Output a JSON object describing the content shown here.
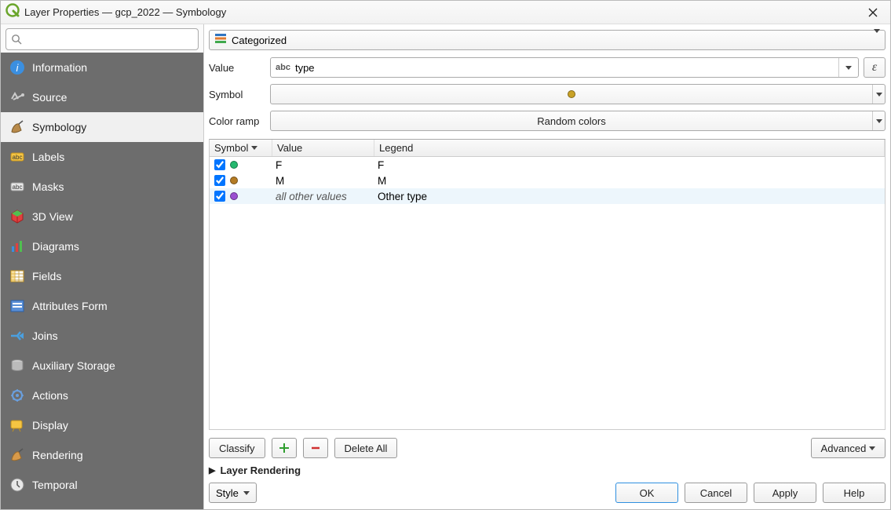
{
  "title": "Layer Properties — gcp_2022 — Symbology",
  "search": {
    "placeholder": ""
  },
  "sidebar": {
    "items": [
      {
        "id": "information",
        "label": "Information"
      },
      {
        "id": "source",
        "label": "Source"
      },
      {
        "id": "symbology",
        "label": "Symbology"
      },
      {
        "id": "labels",
        "label": "Labels"
      },
      {
        "id": "masks",
        "label": "Masks"
      },
      {
        "id": "3dview",
        "label": "3D View"
      },
      {
        "id": "diagrams",
        "label": "Diagrams"
      },
      {
        "id": "fields",
        "label": "Fields"
      },
      {
        "id": "attributes-form",
        "label": "Attributes Form"
      },
      {
        "id": "joins",
        "label": "Joins"
      },
      {
        "id": "auxiliary-storage",
        "label": "Auxiliary Storage"
      },
      {
        "id": "actions",
        "label": "Actions"
      },
      {
        "id": "display",
        "label": "Display"
      },
      {
        "id": "rendering",
        "label": "Rendering"
      },
      {
        "id": "temporal",
        "label": "Temporal"
      }
    ],
    "selected": "symbology"
  },
  "renderer": {
    "type": "Categorized"
  },
  "params": {
    "value_label": "Value",
    "value_prefix": "abc",
    "value_field": "type",
    "symbol_label": "Symbol",
    "symbol_color": "#c9a227",
    "color_ramp_label": "Color ramp",
    "color_ramp_value": "Random colors"
  },
  "class_table": {
    "headers": {
      "symbol": "Symbol",
      "value": "Value",
      "legend": "Legend"
    },
    "rows": [
      {
        "checked": true,
        "color": "#25b86f",
        "value": "F",
        "legend": "F",
        "italic": false,
        "highlight": false
      },
      {
        "checked": true,
        "color": "#b47b24",
        "value": "M",
        "legend": "M",
        "italic": false,
        "highlight": false
      },
      {
        "checked": true,
        "color": "#9b4fd1",
        "value": "all other values",
        "legend": "Other type",
        "italic": true,
        "highlight": true
      }
    ]
  },
  "actions": {
    "classify": "Classify",
    "delete_all": "Delete All",
    "advanced": "Advanced"
  },
  "collapse": {
    "layer_rendering": "Layer Rendering"
  },
  "bottom": {
    "style": "Style",
    "ok": "OK",
    "cancel": "Cancel",
    "apply": "Apply",
    "help": "Help"
  },
  "expr_button": "ε"
}
